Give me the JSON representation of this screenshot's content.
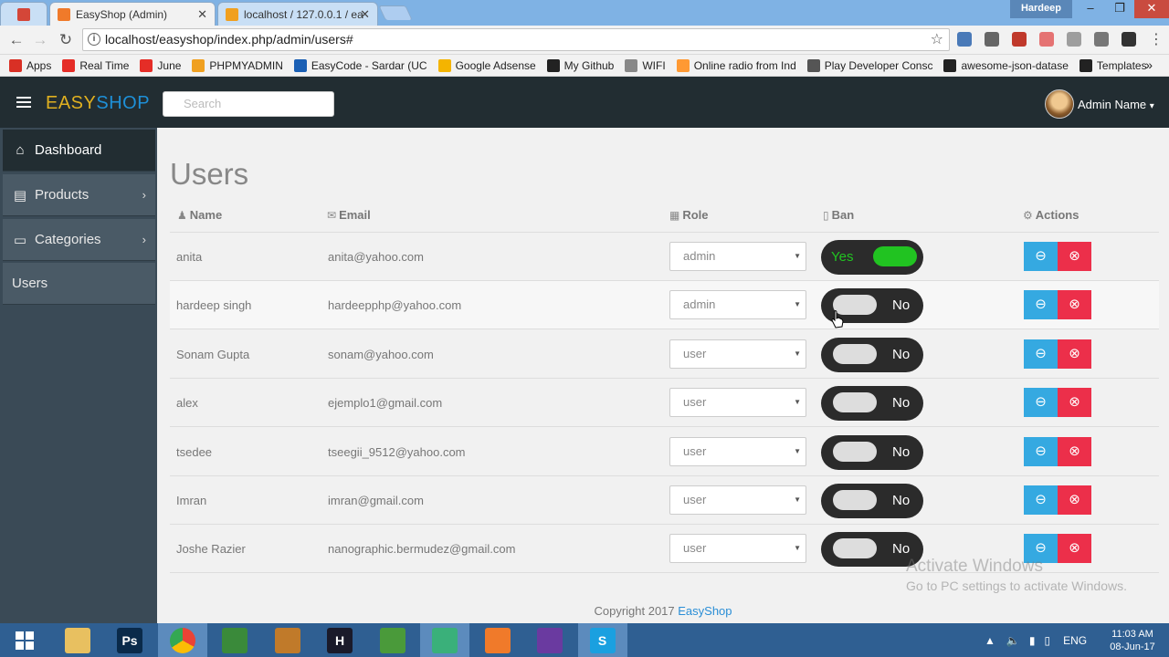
{
  "browser": {
    "tabs": [
      {
        "label": "",
        "icon": "gmail-icon"
      },
      {
        "label": "EasyShop (Admin)",
        "icon": "easyshop-favicon"
      },
      {
        "label": "localhost / 127.0.0.1 / ea",
        "icon": "phpmyadmin-favicon"
      }
    ],
    "window_user": "Hardeep",
    "url": "localhost/easyshop/index.php/admin/users#",
    "bookmarks": [
      {
        "label": "Apps",
        "icon": "apps-grid-icon",
        "color": "#d93025"
      },
      {
        "label": "Real Time",
        "icon": "youtube-icon",
        "color": "#e52d27"
      },
      {
        "label": "June",
        "icon": "youtube-icon",
        "color": "#e52d27"
      },
      {
        "label": "PHPMYADMIN",
        "icon": "phpmyadmin-icon",
        "color": "#f0a020"
      },
      {
        "label": "EasyCode - Sardar (UC",
        "icon": "lc-icon",
        "color": "#1a5fb4"
      },
      {
        "label": "Google Adsense",
        "icon": "adsense-icon",
        "color": "#f4b400"
      },
      {
        "label": "My Github",
        "icon": "github-icon",
        "color": "#222222"
      },
      {
        "label": "WIFI",
        "icon": "page-icon",
        "color": "#888888"
      },
      {
        "label": "Online radio from Ind",
        "icon": "india-flag-icon",
        "color": "#ff9933"
      },
      {
        "label": "Play Developer Consc",
        "icon": "play-icon",
        "color": "#555555"
      },
      {
        "label": "awesome-json-datase",
        "icon": "github-icon",
        "color": "#222222"
      },
      {
        "label": "Templates",
        "icon": "templates-icon",
        "color": "#222222"
      }
    ]
  },
  "navbar": {
    "brand_part1": "EASY",
    "brand_part2": "SHOP",
    "search_placeholder": "Search",
    "admin_name": "Admin Name",
    "admin_caret": "▾"
  },
  "sidebar": {
    "items": [
      {
        "label": "Dashboard",
        "icon": "home-icon",
        "glyph": "⌂",
        "chevron": ""
      },
      {
        "label": "Products",
        "icon": "list-icon",
        "glyph": "▤",
        "chevron": "›"
      },
      {
        "label": "Categories",
        "icon": "monitor-icon",
        "glyph": "▭",
        "chevron": "›"
      },
      {
        "label": "Users",
        "icon": "",
        "glyph": "",
        "chevron": ""
      }
    ]
  },
  "page": {
    "title": "Users",
    "columns": {
      "name": "Name",
      "email": "Email",
      "role": "Role",
      "ban": "Ban",
      "actions": "Actions"
    },
    "toggle_yes": "Yes",
    "toggle_no": "No",
    "ban_glyph": "⊖",
    "delete_glyph": "⊗",
    "select_arrow": "▼"
  },
  "users": [
    {
      "name": "anita",
      "email": "anita@yahoo.com",
      "role": "admin",
      "banned": true
    },
    {
      "name": "hardeep singh",
      "email": "hardeepphp@yahoo.com",
      "role": "admin",
      "banned": false
    },
    {
      "name": "Sonam Gupta",
      "email": "sonam@yahoo.com",
      "role": "user",
      "banned": false
    },
    {
      "name": "alex",
      "email": "ejemplo1@gmail.com",
      "role": "user",
      "banned": false
    },
    {
      "name": "tsedee",
      "email": "tseegii_9512@yahoo.com",
      "role": "user",
      "banned": false
    },
    {
      "name": "Imran",
      "email": "imran@gmail.com",
      "role": "user",
      "banned": false
    },
    {
      "name": "Joshe Razier",
      "email": "nanographic.bermudez@gmail.com",
      "role": "user",
      "banned": false
    }
  ],
  "footer": {
    "copyright": "Copyright 2017 ",
    "brand_link": "EasyShop"
  },
  "watermark": {
    "line1": "Activate Windows",
    "line2": "Go to PC settings to activate Windows."
  },
  "taskbar": {
    "apps": [
      {
        "icon": "windows-start-icon",
        "color": "#2f5f92",
        "text": ""
      },
      {
        "icon": "file-explorer-icon",
        "color": "#e8c060",
        "text": ""
      },
      {
        "icon": "photoshop-icon",
        "color": "#0a2a4a",
        "text": "Ps"
      },
      {
        "icon": "chrome-icon",
        "color": "#34a853",
        "text": ""
      },
      {
        "icon": "globe-app-icon",
        "color": "#3a8a3a",
        "text": ""
      },
      {
        "icon": "fruit-app-icon",
        "color": "#c07a2a",
        "text": ""
      },
      {
        "icon": "h-app-icon",
        "color": "#1a1a2a",
        "text": "H"
      },
      {
        "icon": "chart-app-icon",
        "color": "#4a9a3a",
        "text": ""
      },
      {
        "icon": "atom-icon",
        "color": "#3ab07a",
        "text": ""
      },
      {
        "icon": "xampp-icon",
        "color": "#f07a2a",
        "text": ""
      },
      {
        "icon": "github-desktop-icon",
        "color": "#6a3aa0",
        "text": ""
      },
      {
        "icon": "skype-icon",
        "color": "#1aa0e0",
        "text": "S"
      }
    ],
    "lang": "ENG",
    "time": "11:03 AM",
    "date": "08-Jun-17"
  }
}
